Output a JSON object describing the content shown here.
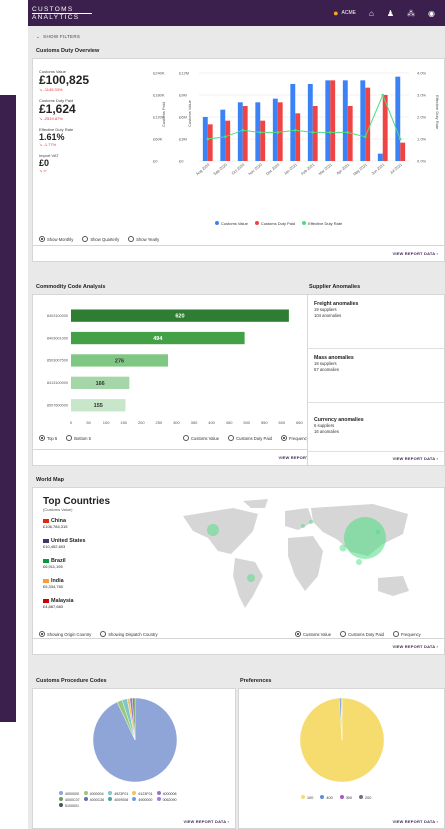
{
  "header": {
    "logo_line1": "CUSTOMS",
    "logo_line2": "ANALYTICS",
    "user_name": "ACME"
  },
  "filters": {
    "label": "SHOW FILTERS"
  },
  "overview": {
    "title": "Customs Duty Overview",
    "kpis": [
      {
        "label": "Customs Value",
        "value": "£100,825",
        "delta": "-1145.33%"
      },
      {
        "label": "Customs Duty Paid",
        "value": "£1,624",
        "delta": "-2519.87%"
      },
      {
        "label": "Effective Duty Rate",
        "value": "1.61%",
        "delta": "-1.77%"
      },
      {
        "label": "Import VAT",
        "value": "£0",
        "delta": "∞"
      }
    ],
    "radios": [
      "Show Monthly",
      "Show Quarterly",
      "Show Yearly"
    ],
    "view_report": "VIEW REPORT DATA"
  },
  "chart_overview": {
    "type": "bar",
    "categories": [
      "Aug 2020",
      "Sep 2020",
      "Oct 2020",
      "Nov 2020",
      "Dec 2020",
      "Jan 2021",
      "Feb 2021",
      "Mar 2021",
      "Apr 2021",
      "May 2021",
      "Jun 2021",
      "Jul 2021"
    ],
    "series": [
      {
        "name": "Customs Value",
        "values": [
          12,
          14,
          16,
          16,
          17,
          21,
          21,
          22,
          22,
          22,
          2,
          23
        ],
        "color": "#3b82f6"
      },
      {
        "name": "Customs Duty Paid",
        "values": [
          10,
          11,
          15,
          11,
          16,
          13,
          15,
          22,
          15,
          20,
          18,
          5
        ],
        "color": "#ef4444"
      },
      {
        "name": "Effective Duty Rate",
        "values": [
          1.0,
          1.1,
          1.4,
          1.3,
          1.3,
          1.4,
          1.3,
          1.3,
          1.3,
          1.1,
          3.0,
          1.0
        ],
        "color": "#4ade80"
      }
    ],
    "left_ticks_outer": [
      "£240K",
      "£180K",
      "£120K",
      "£60K",
      "£0"
    ],
    "left_ticks_inner": [
      "£12M",
      "£9M",
      "£6M",
      "£3M",
      "£0"
    ],
    "right_ticks": [
      "4.0%",
      "3.0%",
      "2.0%",
      "1.0%",
      "0.0%"
    ],
    "ylabel_outer": "Customs Paid",
    "ylabel_inner": "Customs Value",
    "ylabel_right": "Effective Duty Rate"
  },
  "commodity": {
    "title": "Commodity Code Analysis",
    "radios_left": [
      "Top 5",
      "Bottom 5"
    ],
    "radios_right": [
      "Customs Value",
      "Customs Duty Paid",
      "Frequency"
    ],
    "view_report": "VIEW REPORT DATA"
  },
  "chart_commodity": {
    "type": "bar",
    "categories": [
      "8403100000",
      "8403001000",
      "8503007500",
      "8413100000",
      "8507600000"
    ],
    "values": [
      620,
      494,
      276,
      166,
      155
    ],
    "colors": [
      "#2e7d32",
      "#43a047",
      "#81c784",
      "#a5d6a7",
      "#c8e6c9"
    ],
    "x_ticks": [
      "0",
      "50",
      "100",
      "150",
      "200",
      "250",
      "300",
      "350",
      "400",
      "450",
      "500",
      "550",
      "600",
      "650",
      "700"
    ],
    "xlabel": "Frequency",
    "xlim": [
      0,
      700
    ]
  },
  "supplier": {
    "title": "Supplier Anomalies",
    "items": [
      {
        "title": "Freight anomalies",
        "suppliers": "19 suppliers",
        "anomalies": "104 anomalies"
      },
      {
        "title": "Mass anomalies",
        "suppliers": "18 suppliers",
        "anomalies": "57 anomalies"
      },
      {
        "title": "Currency anomalies",
        "suppliers": "6 suppliers",
        "anomalies": "16 anomalies"
      }
    ],
    "view_report": "VIEW REPORT DATA"
  },
  "worldmap": {
    "title": "World Map",
    "heading": "Top Countries",
    "subheading": "(Customs Value)",
    "countries": [
      {
        "name": "China",
        "value": "£106,784,315",
        "flag": "#de2910"
      },
      {
        "name": "United States",
        "value": "£10,452,603",
        "flag": "#3c3b6e"
      },
      {
        "name": "Brazil",
        "value": "£6,911,195",
        "flag": "#009c3b"
      },
      {
        "name": "India",
        "value": "£5,334,760",
        "flag": "#ff9933"
      },
      {
        "name": "Malaysia",
        "value": "£4,887,683",
        "flag": "#cc0001"
      }
    ],
    "radios_left": [
      "Showing Origin Country",
      "Showing Dispatch Country"
    ],
    "radios_right": [
      "Customs Value",
      "Customs Duty Paid",
      "Frequency"
    ],
    "view_report": "VIEW REPORT DATA"
  },
  "cpc": {
    "title": "Customs Procedure Codes",
    "legend": [
      "4000000",
      "4000004",
      "4923F01",
      "6123F01",
      "4000008",
      "4000C07",
      "4000C36",
      "4009008",
      "4900000",
      "0062090",
      "5100001"
    ],
    "legend_colors": [
      "#8fa5d8",
      "#9ac77a",
      "#7ec8c9",
      "#f4c361",
      "#9575cd",
      "#6f9d5c",
      "#5d6fae",
      "#4fa3a1",
      "#6aa0e0",
      "#a57ad6",
      "#4b5563"
    ],
    "radios": [
      "Customs Value",
      "Customs Duty Saved",
      "Frequency"
    ],
    "view_report": "VIEW REPORT DATA"
  },
  "chart_cpc": {
    "type": "pie",
    "values": [
      93,
      2,
      2,
      1,
      1,
      1
    ]
  },
  "preferences": {
    "title": "Preferences",
    "legend": [
      "100",
      "400",
      "300",
      "200"
    ],
    "legend_colors": [
      "#f6dc6e",
      "#5b8fd6",
      "#a757c9",
      "#6b7280"
    ],
    "radios": [
      "Customs Value",
      "Customs Duty Saved",
      "Frequency"
    ],
    "view_report": "VIEW REPORT DATA"
  },
  "chart_pref": {
    "type": "pie",
    "values": [
      99,
      0.6,
      0.2,
      0.2
    ]
  }
}
